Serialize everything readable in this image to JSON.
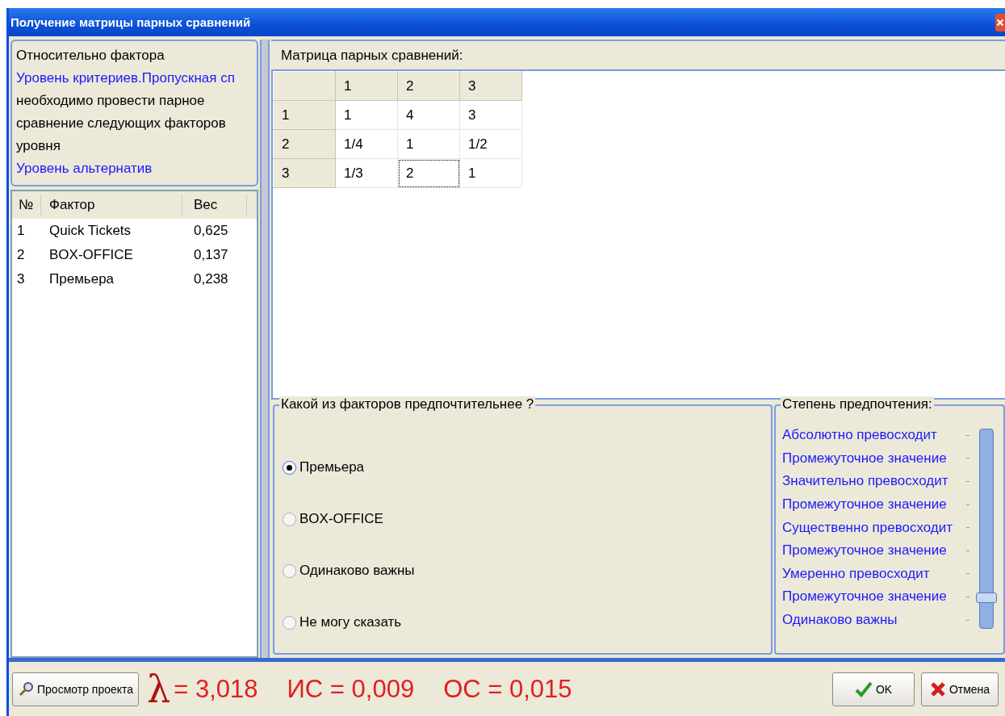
{
  "window": {
    "title": "Получение матрицы парных сравнений"
  },
  "info": {
    "lines": [
      {
        "kind": "plain",
        "text": "Относительно фактора"
      },
      {
        "kind": "link",
        "text": "Уровень критериев.Пропускная сп"
      },
      {
        "kind": "plain",
        "text": "необходимо провести парное сравнение следующих факторов уровня"
      },
      {
        "kind": "link",
        "text": "Уровень альтернатив"
      }
    ]
  },
  "factors": {
    "columns": [
      "№",
      "Фактор",
      "Вес"
    ],
    "rows": [
      {
        "num": "1",
        "name": "Quick Tickets",
        "weight": "0,625"
      },
      {
        "num": "2",
        "name": "BOX-OFFICE",
        "weight": "0,137"
      },
      {
        "num": "3",
        "name": "Премьера",
        "weight": "0,238"
      }
    ]
  },
  "matrix": {
    "title": "Матрица парных сравнений:",
    "columns": [
      "1",
      "2",
      "3"
    ],
    "rows": [
      {
        "header": "1",
        "cells": [
          {
            "value": "1",
            "selected": false
          },
          {
            "value": "4",
            "selected": false
          },
          {
            "value": "3",
            "selected": false
          }
        ]
      },
      {
        "header": "2",
        "cells": [
          {
            "value": "1/4",
            "selected": false
          },
          {
            "value": "1",
            "selected": false
          },
          {
            "value": "1/2",
            "selected": false
          }
        ]
      },
      {
        "header": "3",
        "cells": [
          {
            "value": "1/3",
            "selected": false
          },
          {
            "value": "2",
            "selected": true
          },
          {
            "value": "1",
            "selected": false
          }
        ]
      }
    ]
  },
  "question": {
    "legend": "Какой из факторов предпочтительнее ?",
    "options": [
      {
        "label": "Премьера",
        "selected": true
      },
      {
        "label": "BOX-OFFICE",
        "selected": false
      },
      {
        "label": "Одинаково важны",
        "selected": false
      },
      {
        "label": "Не могу сказать",
        "selected": false
      }
    ]
  },
  "preference": {
    "legend": "Степень предпочтения:",
    "labels": [
      "Абсолютно превосходит",
      "Промежуточное значение",
      "Значительно превосходит",
      "Промежуточное значение",
      "Существенно превосходит",
      "Промежуточное значение",
      "Умеренно превосходит",
      "Промежуточное значение",
      "Одинаково важны"
    ],
    "level": 0.125
  },
  "footer": {
    "view_button": "Просмотр проекта",
    "lambda": "λ",
    "lambda_value": "= 3,018",
    "indices": [
      "ИС = 0,009",
      "ОС = 0,015"
    ],
    "ok_button": "OK",
    "cancel_button": "Отмена"
  }
}
